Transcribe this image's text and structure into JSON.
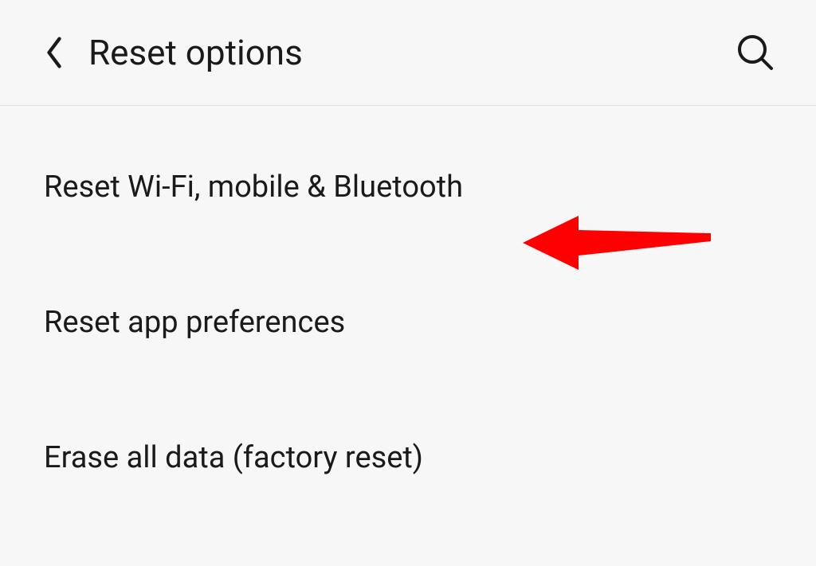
{
  "header": {
    "title": "Reset options"
  },
  "options": [
    {
      "label": "Reset Wi-Fi, mobile & Bluetooth"
    },
    {
      "label": "Reset app preferences"
    },
    {
      "label": "Erase all data (factory reset)"
    }
  ],
  "annotation": {
    "color": "#ff0000"
  }
}
